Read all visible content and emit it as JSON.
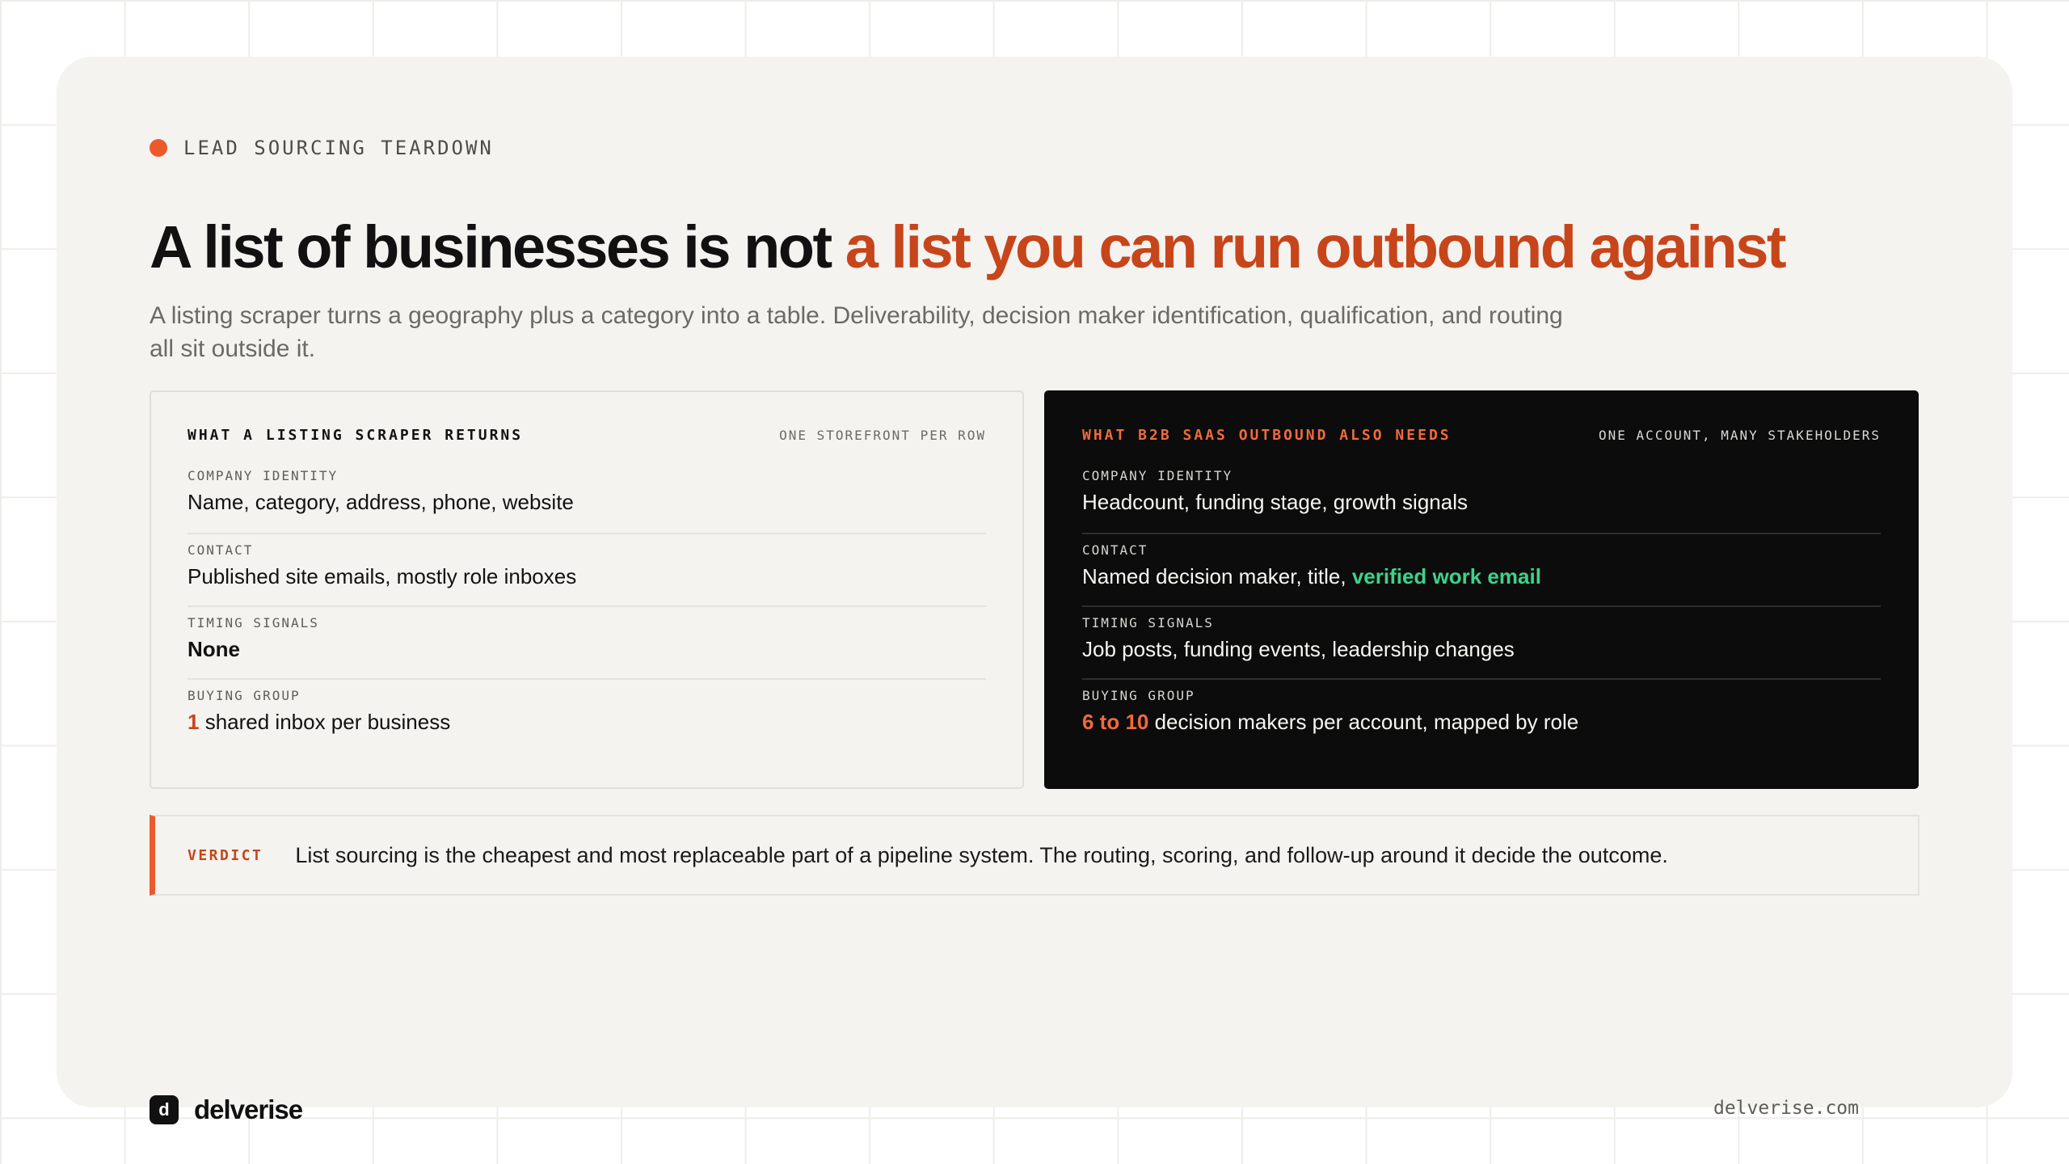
{
  "eyebrow": "LEAD SOURCING TEARDOWN",
  "headline": {
    "lead": "A list of businesses is not ",
    "accent": "a list you can run outbound against"
  },
  "subhead": "A listing scraper turns a geography plus a category into a table. Deliverability, decision maker identification, qualification, and routing all sit outside it.",
  "left_panel": {
    "title": "WHAT A LISTING SCRAPER RETURNS",
    "meta": "ONE STOREFRONT PER ROW",
    "rows": [
      {
        "label": "COMPANY IDENTITY",
        "value": "Name, category, address, phone, website"
      },
      {
        "label": "CONTACT",
        "value": "Published site emails, mostly role inboxes"
      },
      {
        "label": "TIMING SIGNALS",
        "value": "None"
      },
      {
        "label": "BUYING GROUP",
        "value_highlight": "1",
        "value_rest": " shared inbox per business"
      }
    ]
  },
  "right_panel": {
    "title": "WHAT B2B SAAS OUTBOUND ALSO NEEDS",
    "meta": "ONE ACCOUNT, MANY STAKEHOLDERS",
    "rows": [
      {
        "label": "COMPANY IDENTITY",
        "value": "Headcount, funding stage, growth signals"
      },
      {
        "label": "CONTACT",
        "value_lead": "Named decision maker, title, ",
        "value_highlight": "verified work email"
      },
      {
        "label": "TIMING SIGNALS",
        "value": "Job posts, funding events, leadership changes"
      },
      {
        "label": "BUYING GROUP",
        "value_highlight": "6 to 10",
        "value_rest": " decision makers per account, mapped by role"
      }
    ]
  },
  "verdict": {
    "label": "VERDICT",
    "text": "List sourcing is the cheapest and most replaceable part of a pipeline system. The routing, scoring, and follow-up around it decide the outcome."
  },
  "footer": {
    "brand_mark": "d",
    "brand_name": "delverise",
    "site": "delverise.com"
  },
  "colors": {
    "accent": "#c7451a",
    "accent_bright": "#f06a3d",
    "green": "#3ed28a",
    "card_bg": "#f4f3f0",
    "dark_panel": "#0c0c0c"
  }
}
